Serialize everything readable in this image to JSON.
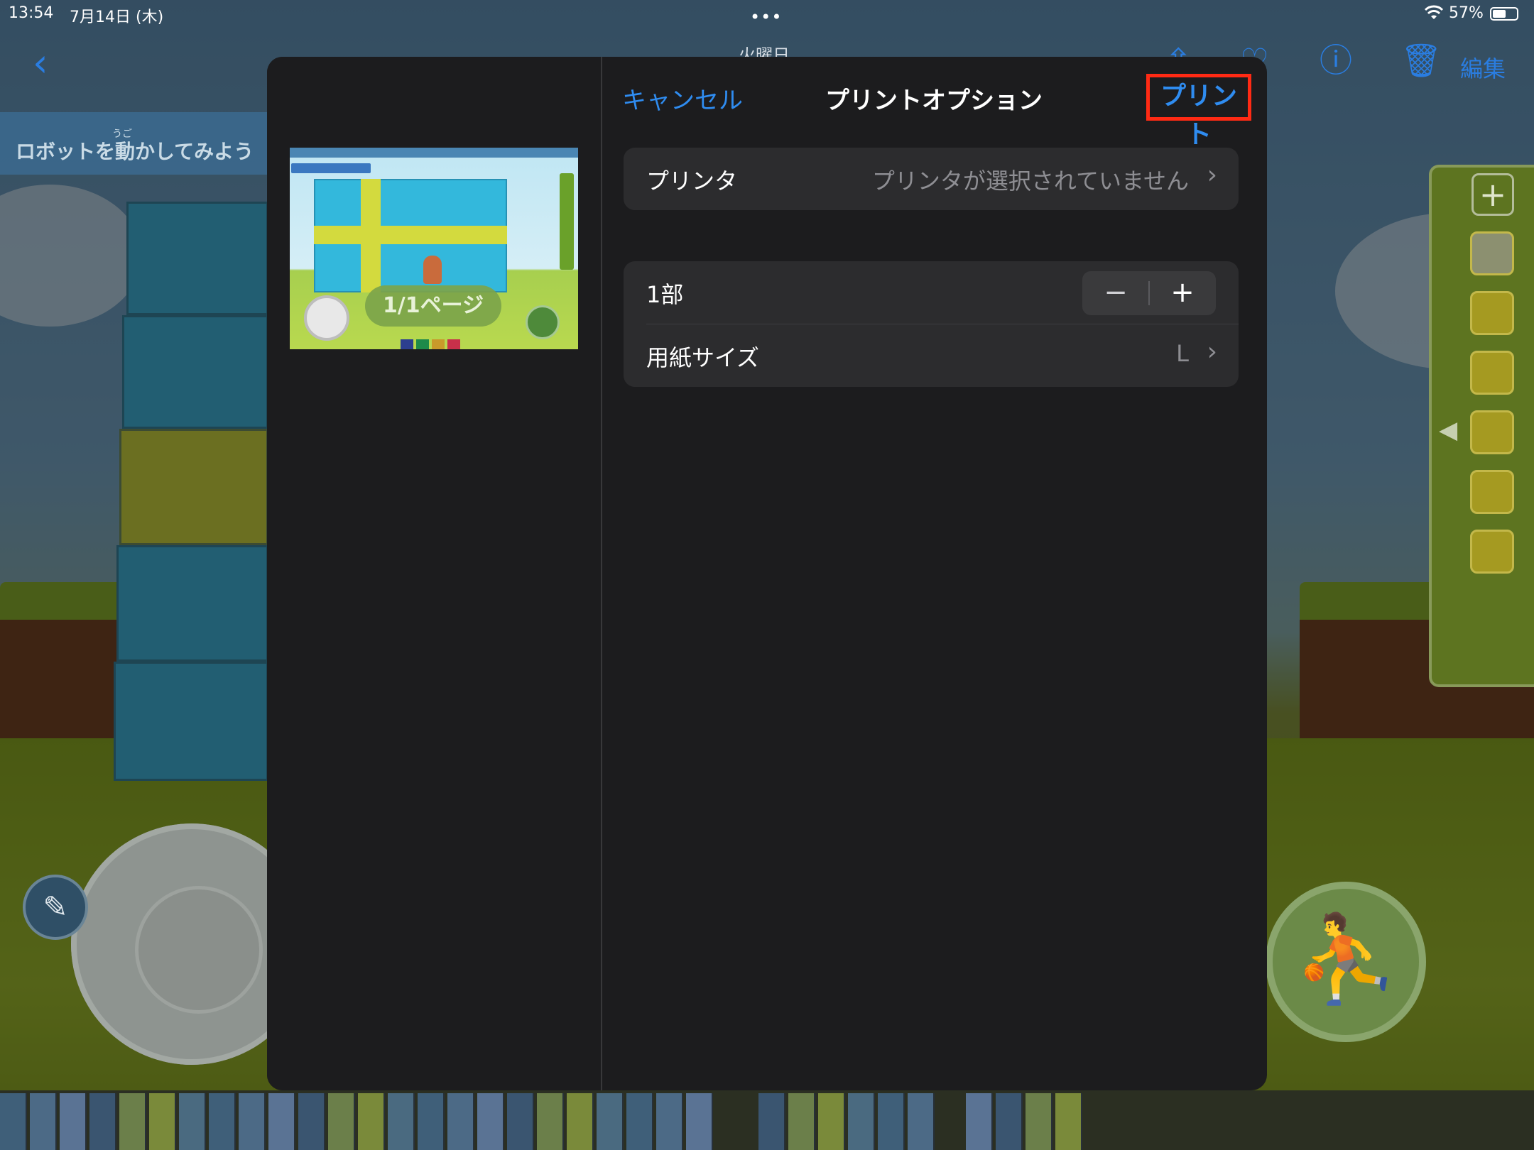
{
  "status_bar": {
    "time": "13:54",
    "date": "7月14日 (木)",
    "dots": "•••",
    "wifi_icon": "wifi",
    "battery_percent": "57%",
    "battery_level": 0.57
  },
  "nav_bar": {
    "title": "火曜日",
    "back_icon": "chevron-left",
    "share_icon": "share",
    "favorite_icon": "heart",
    "info_icon": "info",
    "delete_icon": "trash",
    "edit_label": "編集"
  },
  "background_app": {
    "banner_ruby": "うご",
    "banner_text": "ロボットを動かしてみよう"
  },
  "print_sheet": {
    "cancel_label": "キャンセル",
    "title": "プリントオプション",
    "print_label": "プリント",
    "highlight_color": "#ff2a14",
    "accent_color": "#2f8cf0",
    "preview": {
      "page_label": "1/1ページ"
    },
    "printer_row": {
      "label": "プリンタ",
      "value": "プリンタが選択されていません"
    },
    "copies_row": {
      "label": "1部",
      "minus": "−",
      "plus": "+"
    },
    "paper_row": {
      "label": "用紙サイズ",
      "value": "L"
    }
  }
}
